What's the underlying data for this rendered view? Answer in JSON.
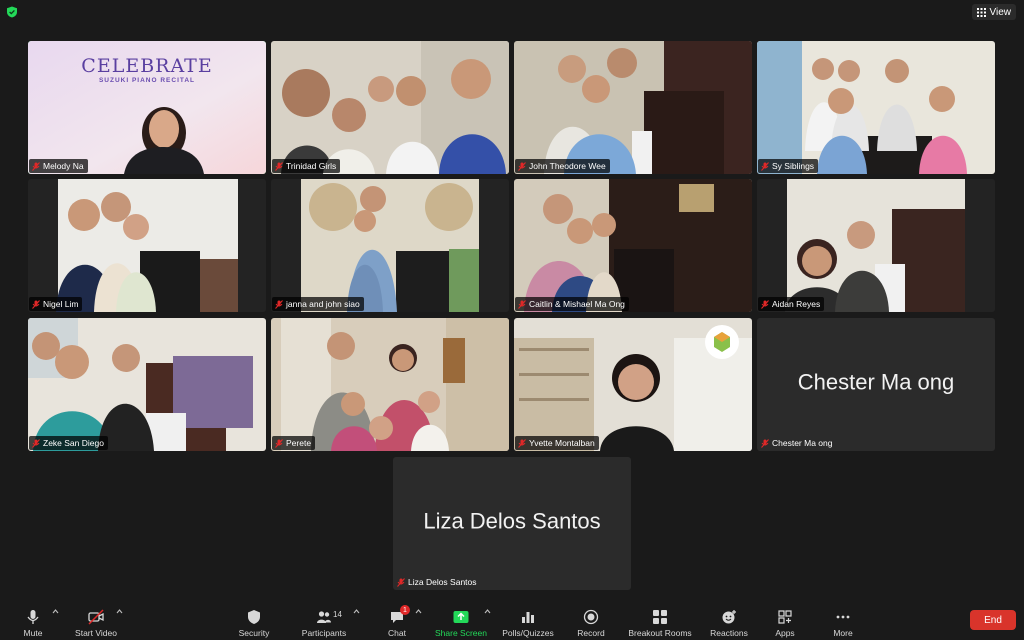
{
  "view_button": {
    "label": "View",
    "icon": "grid-icon"
  },
  "tiles": [
    {
      "name": "Melody Na",
      "muted": true
    },
    {
      "name": "Trinidad Girls",
      "muted": true
    },
    {
      "name": "John Theodore Wee",
      "muted": true
    },
    {
      "name": "Sy Siblings",
      "muted": true
    },
    {
      "name": "Nigel Lim",
      "muted": true
    },
    {
      "name": "janna and john siao",
      "muted": true
    },
    {
      "name": "Caitlin & Mishael Ma Ong",
      "muted": true
    },
    {
      "name": "Aidan Reyes",
      "muted": true
    },
    {
      "name": "Zeke San Diego",
      "muted": true
    },
    {
      "name": "Perete",
      "muted": true
    },
    {
      "name": "Yvette Montalban",
      "muted": true
    },
    {
      "name": "Chester Ma ong",
      "muted": true,
      "big_name": "Chester Ma ong"
    },
    {
      "name": "Liza Delos Santos",
      "muted": true,
      "big_name": "Liza Delos Santos"
    }
  ],
  "background_slide": {
    "title": "CELEBRATE",
    "subtitle": "SUZUKI PIANO RECITAL"
  },
  "toolbar": {
    "mute": "Mute",
    "start_video": "Start Video",
    "security": "Security",
    "participants": "Participants",
    "participants_count": "14",
    "chat": "Chat",
    "chat_badge": "1",
    "share_screen": "Share Screen",
    "polls": "Polls/Quizzes",
    "record": "Record",
    "breakout": "Breakout Rooms",
    "reactions": "Reactions",
    "apps": "Apps",
    "more": "More",
    "end": "End"
  },
  "colors": {
    "background": "#1a1a1a",
    "active_speaker": "#23d959",
    "end_button": "#d9342b",
    "mute_icon": "#e02828",
    "share_green": "#23d959"
  }
}
